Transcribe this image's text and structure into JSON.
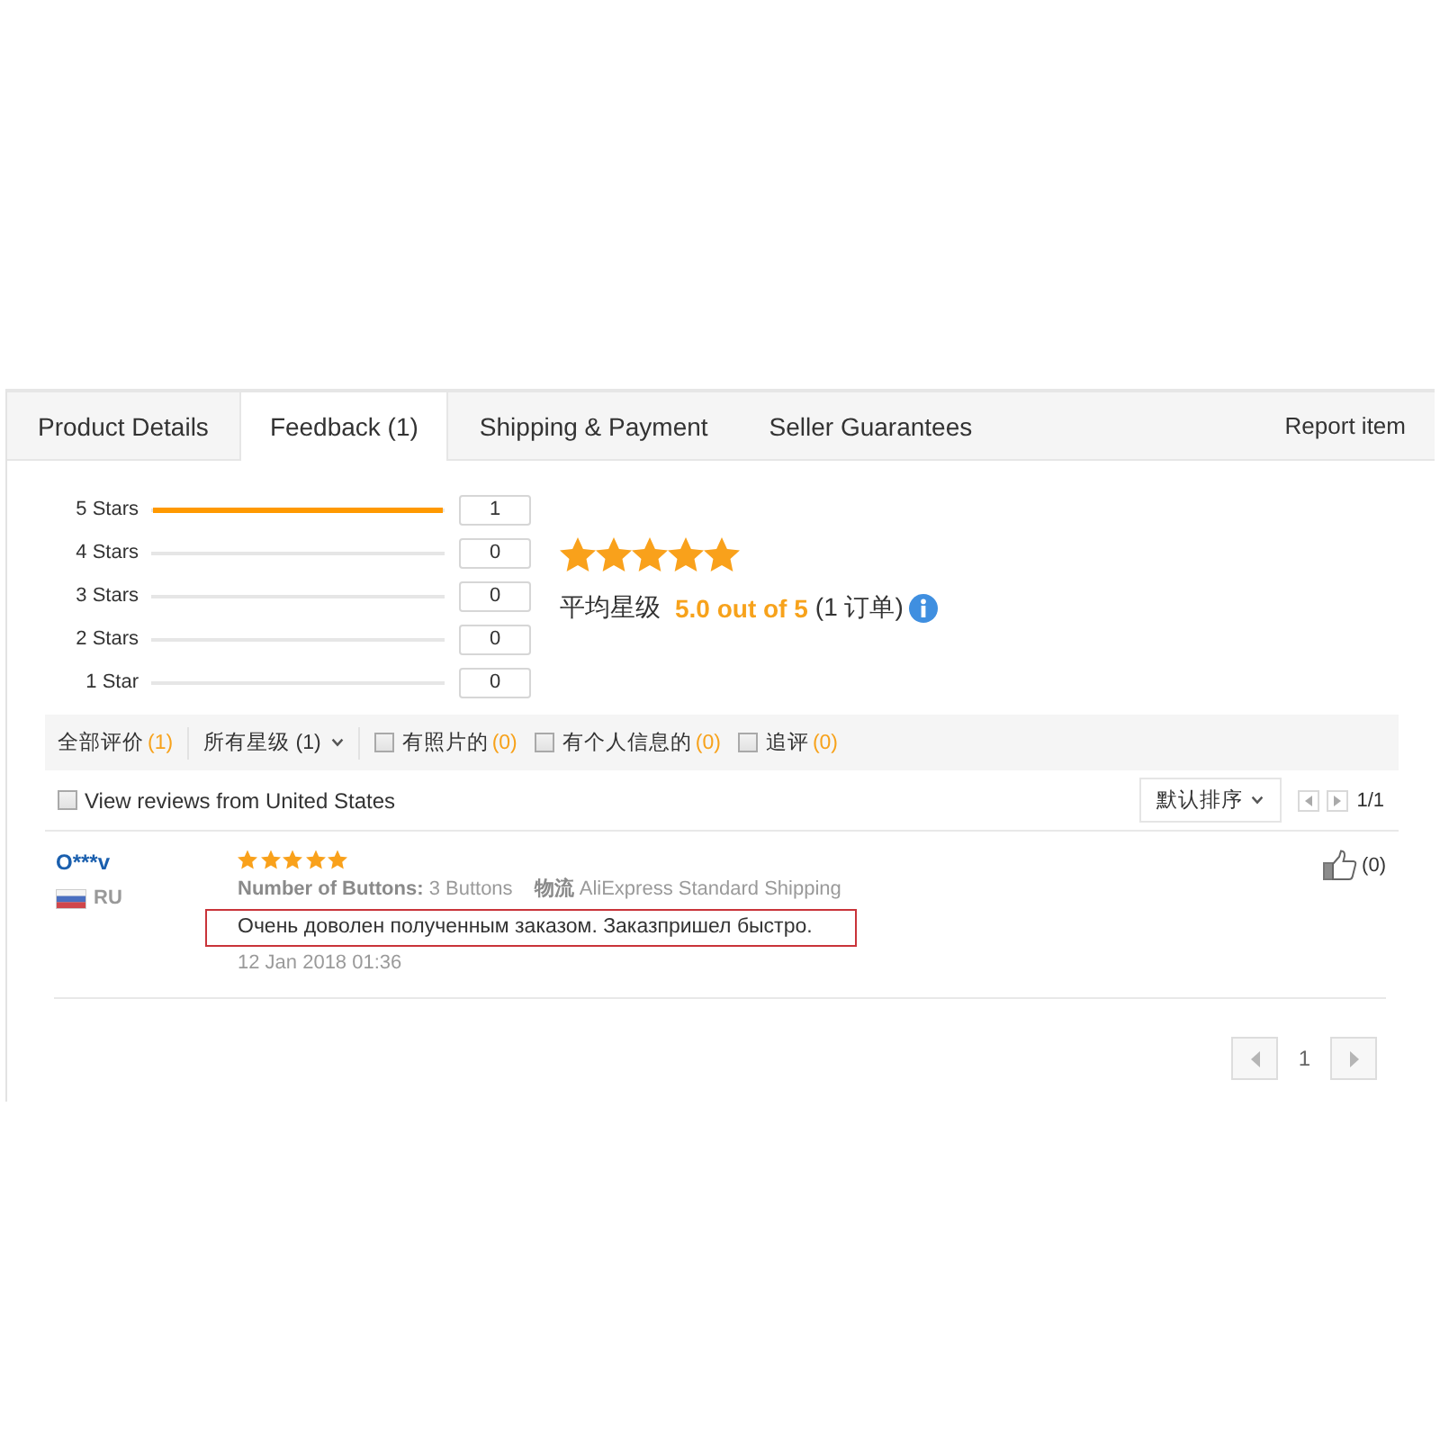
{
  "tabs": [
    {
      "label": "Product Details",
      "selected": false
    },
    {
      "label": "Feedback (1)",
      "selected": true
    },
    {
      "label": "Shipping & Payment",
      "selected": false
    },
    {
      "label": "Seller Guarantees",
      "selected": false
    }
  ],
  "report_link": "Report item",
  "histogram": [
    {
      "label": "5 Stars",
      "level": 1,
      "count": "1"
    },
    {
      "label": "4 Stars",
      "count": "0"
    },
    {
      "label": "3 Stars",
      "count": "0"
    },
    {
      "label": "2 Stars",
      "count": "0"
    },
    {
      "label": "1 Star",
      "count": "0"
    }
  ],
  "summary": {
    "stars": 5,
    "label": "平均星级",
    "score": "5.0 out of 5",
    "orders": "(1 订单)"
  },
  "filters": [
    {
      "kind": "link",
      "label": "全部评价",
      "count": "(1)"
    },
    {
      "kind": "dropdown",
      "label": "所有星级 (1)"
    },
    {
      "kind": "checkbox",
      "label": "有照片的",
      "count": "(0)",
      "checked": false
    },
    {
      "kind": "checkbox",
      "label": "有个人信息的",
      "count": "(0)",
      "checked": false
    },
    {
      "kind": "checkbox",
      "label": "追评",
      "count": "(0)",
      "checked": false
    }
  ],
  "country_filter": {
    "label": "View reviews from United States",
    "checked": false
  },
  "sort": {
    "label": "默认排序"
  },
  "page_indicator": "1/1",
  "reviews": [
    {
      "name": "O***v",
      "country": "RU",
      "stars": 5,
      "details": [
        {
          "name": "Number of Buttons:",
          "value": "3 Buttons"
        },
        {
          "name": "物流",
          "value": "AliExpress Standard Shipping"
        }
      ],
      "text": "Очень доволен полученным заказом. Заказпришел быстро.",
      "highlighted": true,
      "date": "12 Jan 2018 01:36",
      "likes": "(0)"
    }
  ],
  "pagination": [
    {
      "label": "1",
      "selected": true
    }
  ]
}
